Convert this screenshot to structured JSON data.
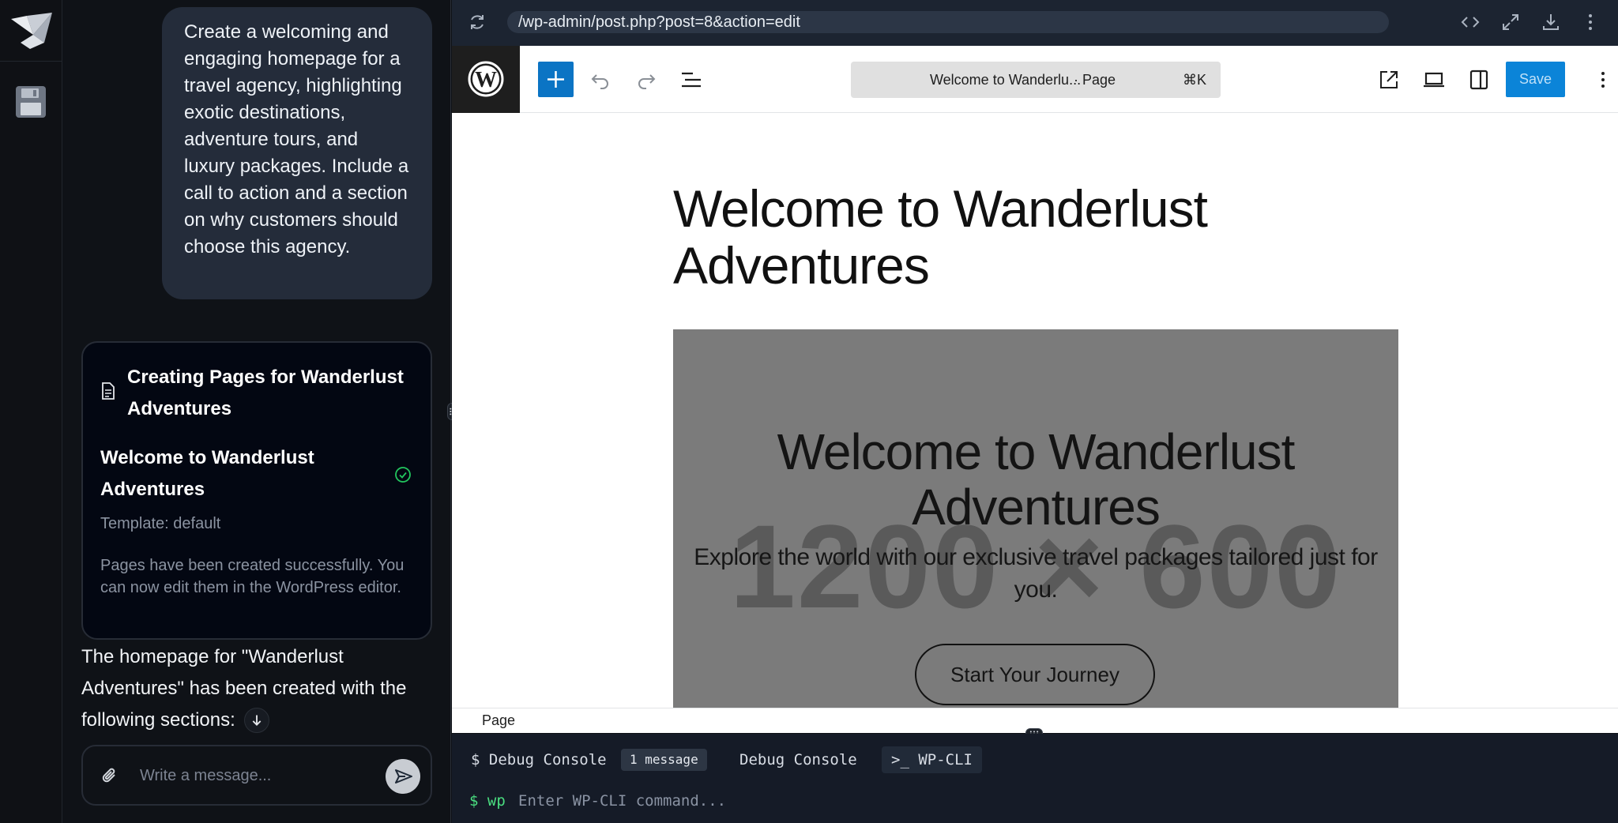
{
  "browser": {
    "url": "/wp-admin/post.php?post=8&action=edit"
  },
  "chat": {
    "user_message": "Create a welcoming and engaging homepage for a travel agency, highlighting exotic destinations, adventure tours, and luxury packages. Include a call to action and a section on why customers should choose this agency.",
    "task_card": {
      "title": "Creating Pages for Wanderlust Adventures",
      "item_title": "Welcome to Wanderlust Adventures",
      "template": "Template: default",
      "message": "Pages have been created successfully. You can now edit them in the WordPress editor."
    },
    "assistant_summary": "The homepage for \"Wanderlust Adventures\" has been created with the following sections:",
    "composer_placeholder": "Write a message..."
  },
  "editor": {
    "doc_title": "Welcome to Wanderlu...",
    "doc_type": "· Page",
    "shortcut": "⌘K",
    "save_label": "Save",
    "page_heading": "Welcome to Wanderlust Adventures",
    "hero": {
      "placeholder_text": "1200 × 600",
      "heading": "Welcome to Wanderlust Adventures",
      "subtitle": "Explore the world with our exclusive travel packages tailored just for you.",
      "cta": "Start Your Journey"
    },
    "breadcrumb": "Page"
  },
  "console": {
    "tab1": "$ Debug Console",
    "tab1_badge": "1 message",
    "tab2": "Debug Console",
    "tab3": ">_ WP-CLI",
    "prompt": "$ wp",
    "input_placeholder": "Enter WP-CLI command..."
  },
  "colors": {
    "wp_blue": "#0b74c4",
    "chat_bubble": "#242c3a",
    "success_green": "#22c55e",
    "console_prompt": "#4ade80"
  }
}
